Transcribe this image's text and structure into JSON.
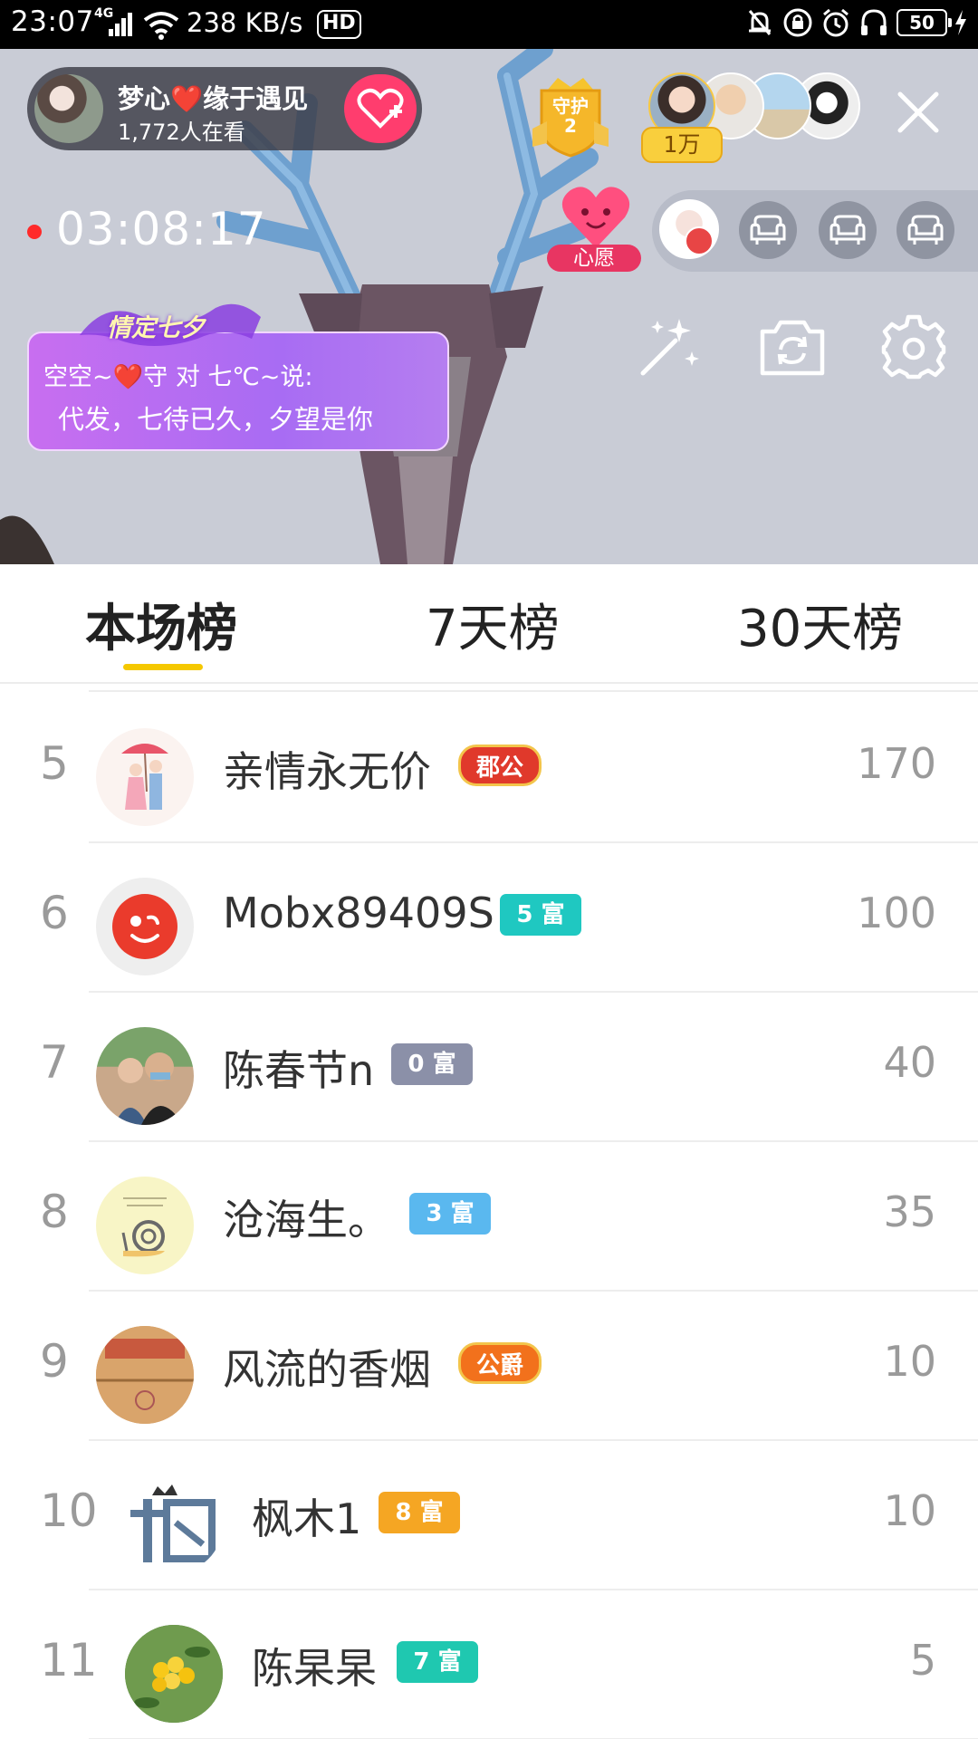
{
  "status_bar": {
    "time": "23:07",
    "network": "4G",
    "speed": "238 KB/s",
    "hd": "HD",
    "battery": "50"
  },
  "live": {
    "host_name": "梦心❤️缘于遇见",
    "viewer_count": "1,772人在看",
    "guard_label": "守护",
    "guard_count": "2",
    "top_fan_badge": "1万",
    "timer": "03:08:17",
    "wish_label": "心愿",
    "banner_tag": "情定七夕",
    "banner_line1": "空空~❤️守 对 七℃~说:",
    "banner_line2": "代发，七待已久，夕望是你"
  },
  "tabs": [
    {
      "label": "本场榜",
      "active": true
    },
    {
      "label": "7天榜",
      "active": false
    },
    {
      "label": "30天榜",
      "active": false
    }
  ],
  "leaderboard": [
    {
      "rank": "5",
      "name": "亲情永无价",
      "badge": "郡公",
      "badge_type": "title",
      "badge_color": "#e0392b",
      "score": "170"
    },
    {
      "rank": "6",
      "name": "Mobx89409S",
      "badge": "5 富",
      "badge_type": "level",
      "badge_color": "#1fc8c1",
      "score": "100"
    },
    {
      "rank": "7",
      "name": "陈春节n",
      "badge": "0 富",
      "badge_type": "level",
      "badge_color": "#8b90a8",
      "score": "40"
    },
    {
      "rank": "8",
      "name": "沧海生。",
      "badge": "3 富",
      "badge_type": "level",
      "badge_color": "#5ab8ef",
      "score": "35"
    },
    {
      "rank": "9",
      "name": "风流的香烟",
      "badge": "公爵",
      "badge_type": "title",
      "badge_color": "#f2711c",
      "score": "10"
    },
    {
      "rank": "10",
      "name": "枫木1",
      "badge": "8 富",
      "badge_type": "level",
      "badge_color": "#f5a623",
      "score": "10"
    },
    {
      "rank": "11",
      "name": "陈杲杲",
      "badge": "7 富",
      "badge_type": "level",
      "badge_color": "#1fc8b0",
      "score": "5"
    }
  ],
  "colors": {
    "tab_underline": "#f5c800",
    "live_dot": "#ff2a2a",
    "follow_button": "#ff3d6e"
  }
}
